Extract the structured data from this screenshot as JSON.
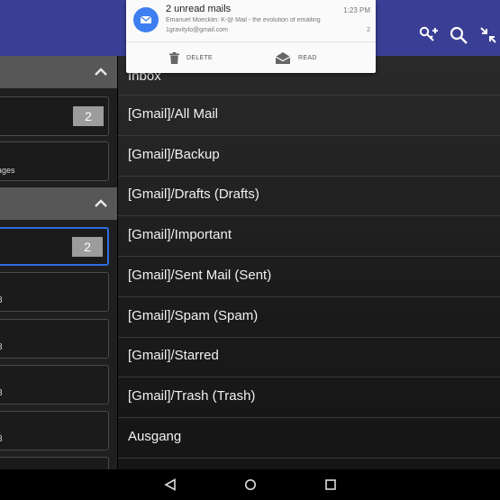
{
  "notification": {
    "title": "2 unread mails",
    "time": "1:23 PM",
    "line1": "Emanuel Moecklin: K-@ Mail - the evolution of emailing",
    "line2": "1gravitylo@gmail.com",
    "count": "2",
    "actions": [
      {
        "label": "DELETE",
        "icon": "trash-icon"
      },
      {
        "label": "READ",
        "icon": "open-envelope-icon"
      }
    ]
  },
  "toolbar": {
    "icons": [
      "key-add-icon",
      "search-icon",
      "collapse-icon"
    ]
  },
  "accounts": {
    "card1_badge": "2",
    "card2_sub": "ages",
    "card3_badge": "2",
    "small_counts": [
      "8",
      "8",
      "8",
      "8"
    ]
  },
  "folders": [
    "Inbox",
    "[Gmail]/All Mail",
    "[Gmail]/Backup",
    "[Gmail]/Drafts (Drafts)",
    "[Gmail]/Important",
    "[Gmail]/Sent Mail (Sent)",
    "[Gmail]/Spam (Spam)",
    "[Gmail]/Starred",
    "[Gmail]/Trash (Trash)",
    "Ausgang"
  ],
  "colors": {
    "app_bar": "#3a3f95",
    "selected_border": "#2f6de0",
    "notif_accent": "#3d7ef0"
  },
  "navigation": {
    "icons": [
      "back-icon",
      "home-icon",
      "recents-icon"
    ]
  }
}
